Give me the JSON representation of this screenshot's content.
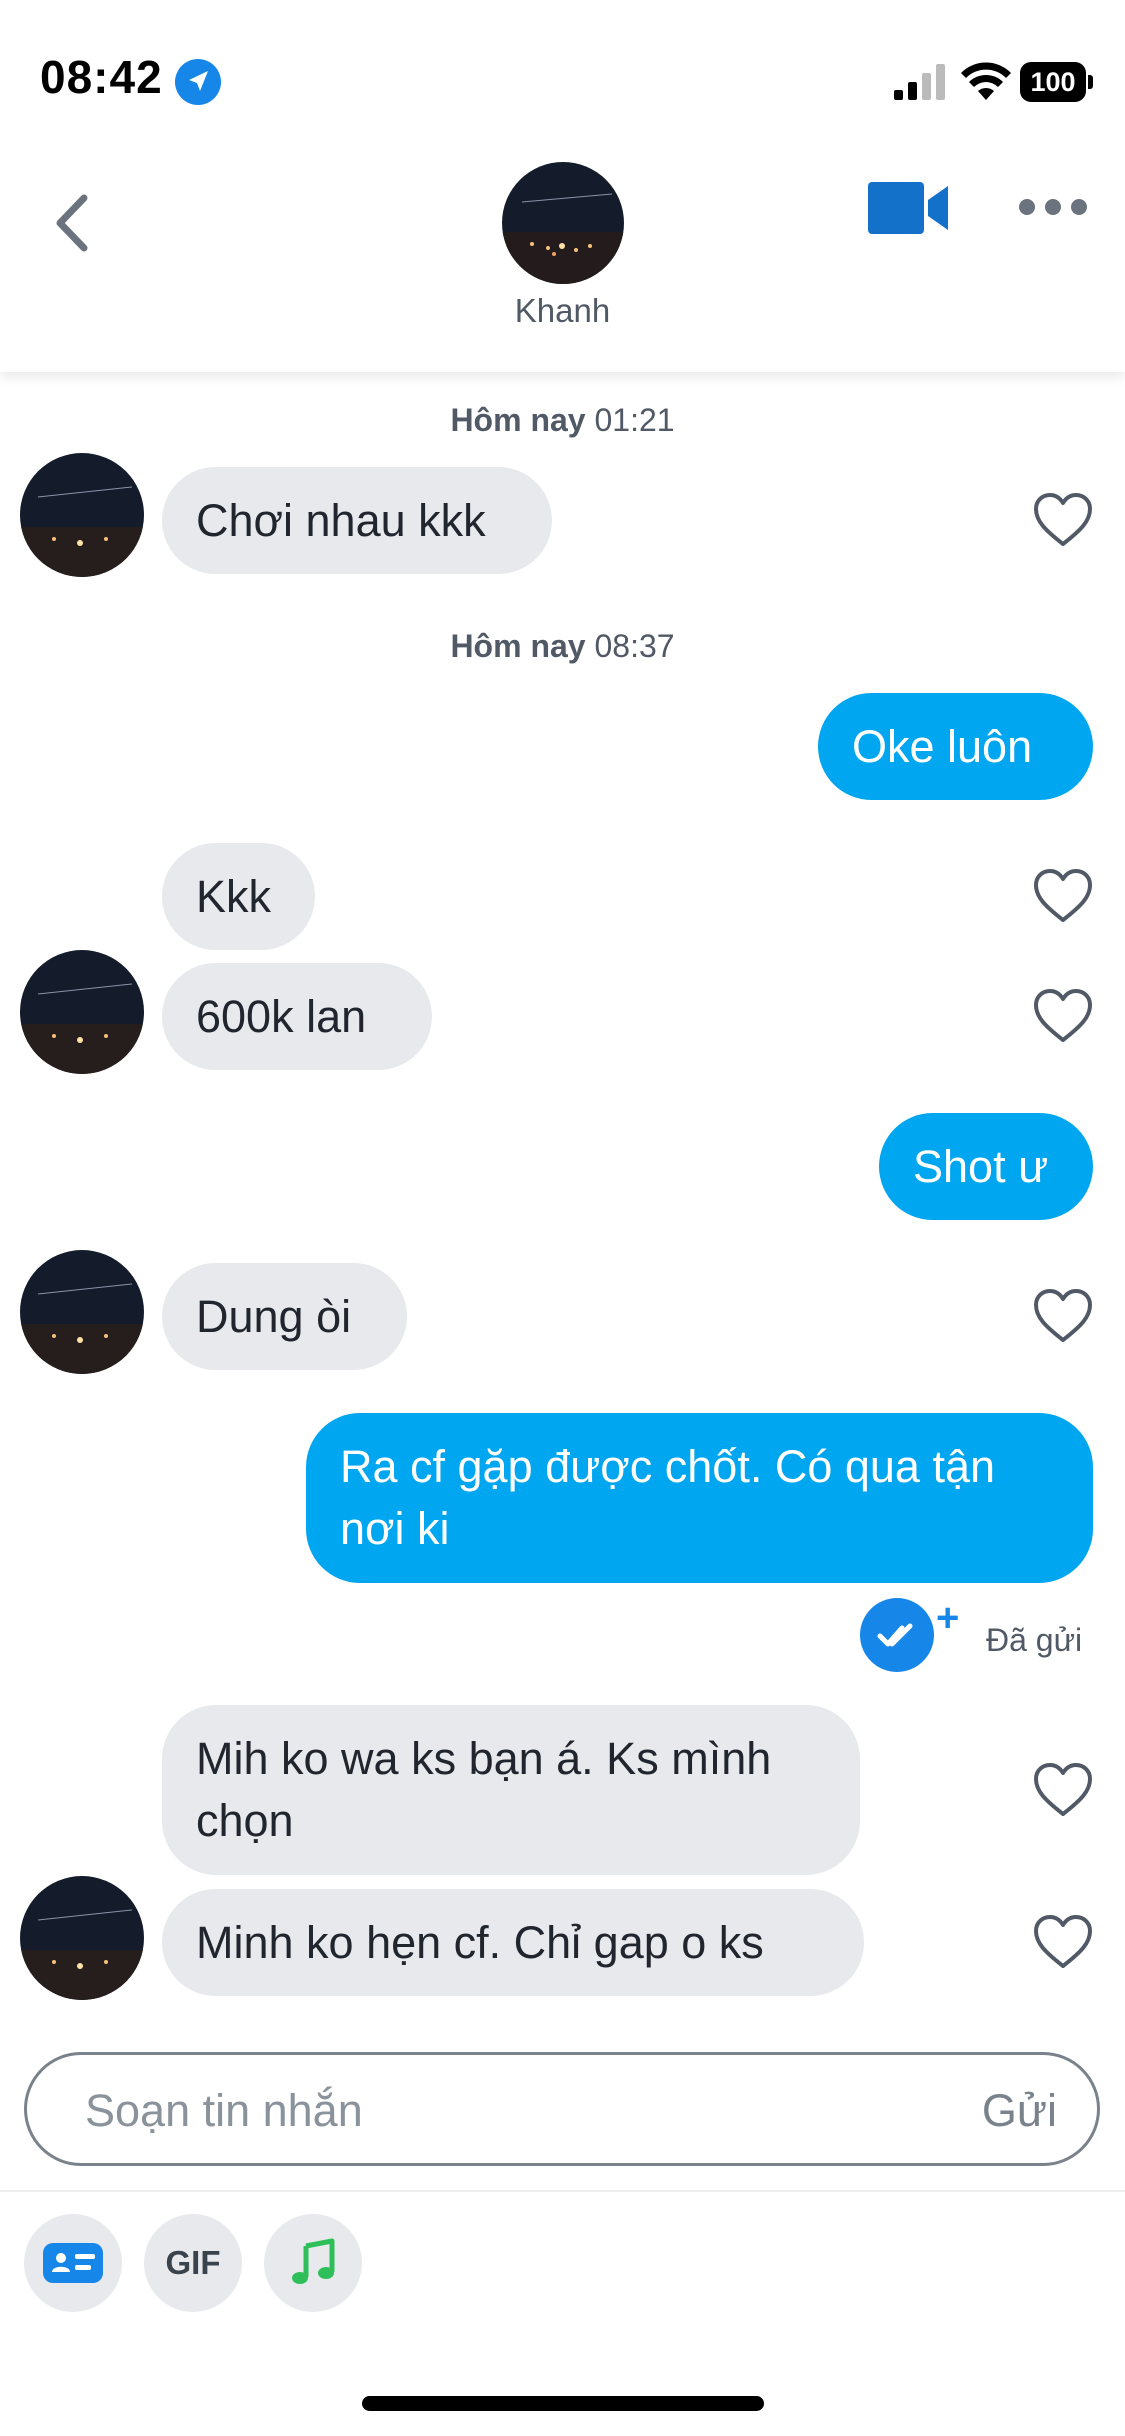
{
  "status_bar": {
    "time": "08:42",
    "battery": "100"
  },
  "header": {
    "contact_name": "Khanh",
    "icons": {
      "back": "chevron-left-icon",
      "video": "video-camera-icon",
      "more": "more-dots-icon"
    }
  },
  "colors": {
    "accent": "#00a6ef",
    "incoming_bubble": "#e8e9ed",
    "read_badge": "#1687e8"
  },
  "conversation": {
    "timestamp_1": {
      "day": "Hôm nay",
      "time": "01:21"
    },
    "timestamp_2": {
      "day": "Hôm nay",
      "time": "08:37"
    },
    "messages": [
      {
        "direction": "in",
        "text": "Chơi nhau kkk"
      },
      {
        "direction": "out",
        "text": "Oke luôn"
      },
      {
        "direction": "in",
        "text": "Kkk"
      },
      {
        "direction": "in",
        "text": "600k lan"
      },
      {
        "direction": "out",
        "text": "Shot ư"
      },
      {
        "direction": "in",
        "text": "Dung òi"
      },
      {
        "direction": "out",
        "text": "Ra cf gặp được chốt. Có qua tận nơi ki"
      },
      {
        "direction": "in",
        "text": "Mih ko wa ks bạn á. Ks mình chọn"
      },
      {
        "direction": "in",
        "text": "Minh ko hẹn cf. Chỉ gap o ks"
      }
    ],
    "sent_status": "Đã gửi"
  },
  "composer": {
    "placeholder": "Soạn tin nhắn",
    "send_label": "Gửi"
  },
  "toolbar": {
    "gif_label": "GIF",
    "icons": [
      "sticker-card-icon",
      "gif-icon",
      "music-note-icon"
    ]
  }
}
